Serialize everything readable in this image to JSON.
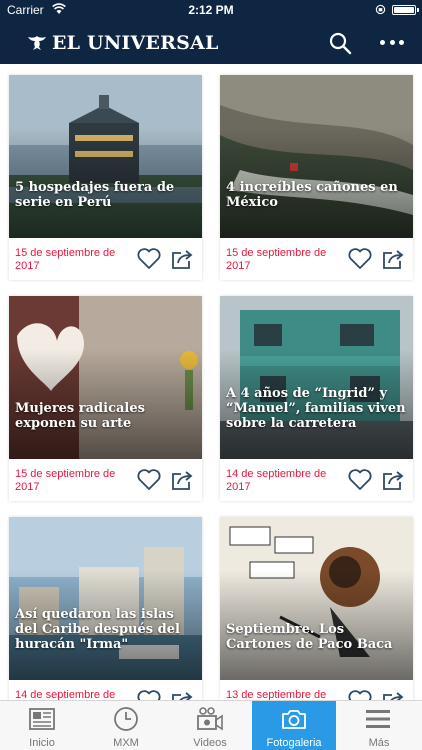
{
  "status": {
    "carrier": "Carrier",
    "time": "2:12 PM"
  },
  "header": {
    "brand": "EL UNIVERSAL",
    "search_icon": "search-icon",
    "more_icon": "more-dots-icon"
  },
  "cards": [
    {
      "title": "5 hospedajes fuera de serie en Perú",
      "date": "15 de septiembre de 2017"
    },
    {
      "title": "4 increíbles cañones en México",
      "date": "15 de septiembre de 2017"
    },
    {
      "title": "Mujeres radicales exponen su arte",
      "date": "15 de septiembre de 2017"
    },
    {
      "title": "A 4 años de “Ingrid” y “Manuel”, familias viven sobre la carretera",
      "date": "14 de septiembre de 2017"
    },
    {
      "title": "Así quedaron las islas del Caribe después del huracán \"Irma\"",
      "date": "14 de septiembre de"
    },
    {
      "title": "Septiembre. Los Cartones de Paco Baca",
      "date": "13 de septiembre de"
    }
  ],
  "tabs": [
    {
      "label": "Inicio",
      "icon": "newspaper-icon"
    },
    {
      "label": "MXM",
      "icon": "clock-icon"
    },
    {
      "label": "Videos",
      "icon": "video-camera-icon"
    },
    {
      "label": "Fotogaleria",
      "icon": "camera-icon"
    },
    {
      "label": "Más",
      "icon": "menu-icon"
    }
  ],
  "colors": {
    "header": "#0f2642",
    "accent": "#2a9ae6",
    "date": "#e8173d"
  }
}
